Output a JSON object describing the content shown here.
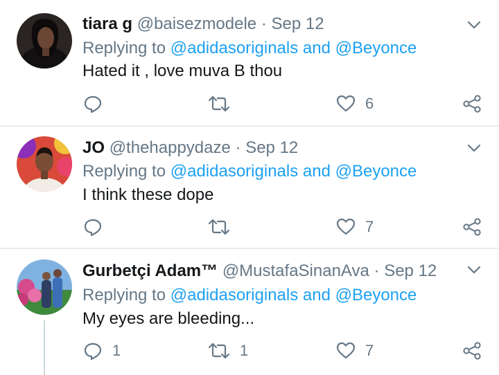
{
  "colors": {
    "link": "#1da1f2",
    "muted": "#657786",
    "text": "#14171a",
    "divider": "#e6ecf0"
  },
  "tweets": [
    {
      "name": "tiara g",
      "handle": "@baisezmodele",
      "separator": "·",
      "date": "Sep 12",
      "replying_prefix": "Replying to",
      "replying_targets": "@adidasoriginals and @Beyonce",
      "text": "Hated it , love muva B thou",
      "replies": "",
      "retweets": "",
      "likes": "6",
      "icons": [
        "chevron-down-icon",
        "reply-icon",
        "retweet-icon",
        "heart-icon",
        "share-icon"
      ]
    },
    {
      "name": "JO",
      "handle": "@thehappydaze",
      "separator": "·",
      "date": "Sep 12",
      "replying_prefix": "Replying to",
      "replying_targets": "@adidasoriginals and @Beyonce",
      "text": "I think these dope",
      "replies": "",
      "retweets": "",
      "likes": "7",
      "icons": [
        "chevron-down-icon",
        "reply-icon",
        "retweet-icon",
        "heart-icon",
        "share-icon"
      ]
    },
    {
      "name": "Gurbetçi Adam™",
      "handle": "@MustafaSinanAva",
      "separator": "·",
      "date": "Sep 12",
      "replying_prefix": "Replying to",
      "replying_targets": "@adidasoriginals and @Beyonce",
      "text": "My eyes are bleeding...",
      "replies": "1",
      "retweets": "1",
      "likes": "7",
      "icons": [
        "chevron-down-icon",
        "reply-icon",
        "retweet-icon",
        "heart-icon",
        "share-icon"
      ]
    }
  ]
}
